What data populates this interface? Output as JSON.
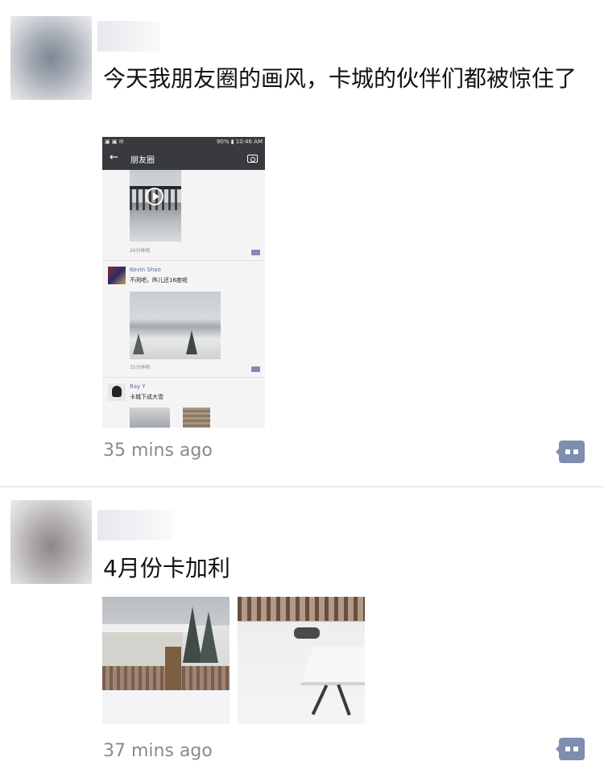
{
  "posts": [
    {
      "text": "今天我朋友圈的画风，卡城的伙伴们都被惊住了",
      "time": "35 mins ago",
      "embedded_screenshot": {
        "status_right": "90% ▮ 10:46 AM",
        "status_left": "▣ ▣ ✉",
        "title": "朋友圈",
        "entries": [
          {
            "time": "26分钟前"
          },
          {
            "name": "Kevin Shao",
            "text": "不闲吧，昨儿还16度呢",
            "time": "35分钟前"
          },
          {
            "name": "Ray Y",
            "text": "卡城下成大雪"
          }
        ]
      }
    },
    {
      "text": "4月份卡加利",
      "time": "37 mins ago"
    }
  ],
  "icons": {
    "comment": "comment-bubble-icon",
    "back": "back-arrow-icon",
    "camera": "camera-icon",
    "play": "play-icon"
  },
  "colors": {
    "comment_button": "#7e8db0",
    "username": "#576b95",
    "timestamp": "#8a8a8a",
    "appbar": "#393a3f"
  }
}
